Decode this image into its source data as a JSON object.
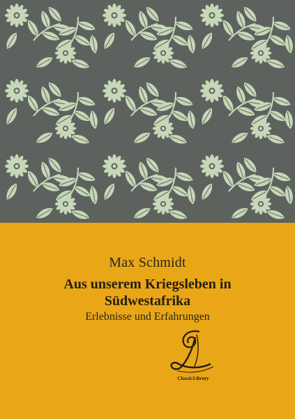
{
  "cover": {
    "author": "Max Schmidt",
    "title_line_1": "Aus unserem Kriegsleben in",
    "title_line_2": "Südwestafrika",
    "subtitle": "Erlebnisse und Erfahrungen",
    "publisher_name": "ClassicLibrary"
  },
  "colors": {
    "pattern_background": "#5d625e",
    "pattern_motif": "#c6d8b8",
    "title_panel": "#e9a617",
    "text": "#2a2518"
  },
  "icons": {
    "pattern": "floral-leaf-pattern",
    "publisher_logo": "classic-library-logo"
  }
}
